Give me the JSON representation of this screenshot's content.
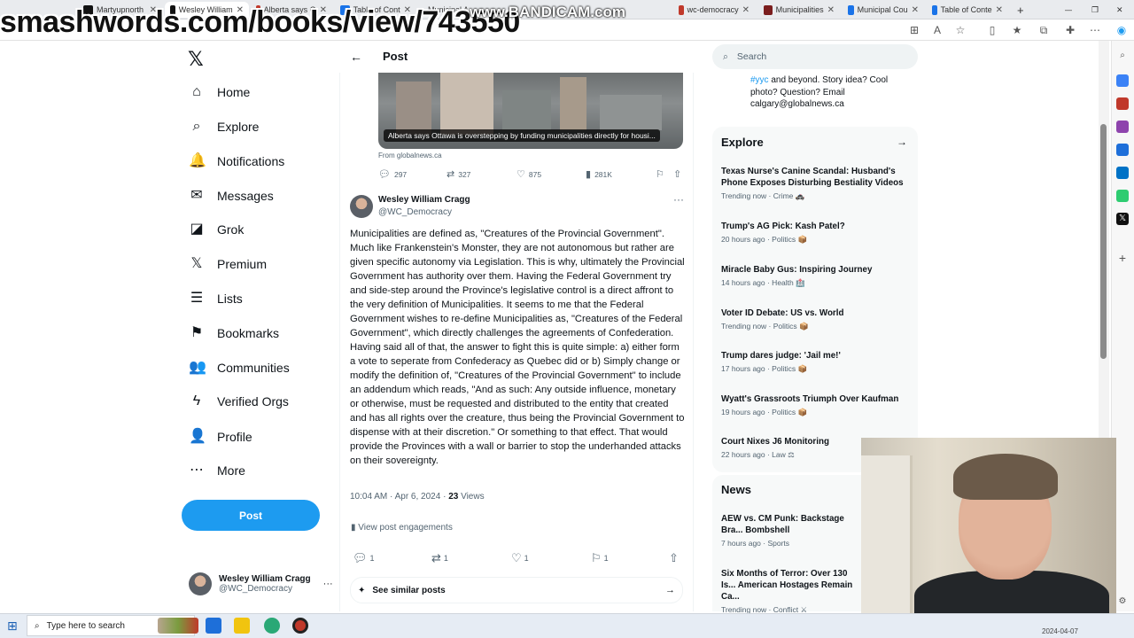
{
  "browser": {
    "tabs": [
      {
        "label": "Martyupnorth",
        "color": "#111111"
      },
      {
        "label": "Wesley William",
        "color": "#111111"
      },
      {
        "label": "Alberta says O",
        "color": "#c0392b"
      },
      {
        "label": "Table of Cont",
        "color": "#1a73e8"
      },
      {
        "label": "Municipal A",
        "color": "#8e44ad"
      },
      {
        "label": "wc-democracy",
        "color": "#c0392b"
      },
      {
        "label": "Municipalities",
        "color": "#7b1e1e"
      },
      {
        "label": "Municipal Cou",
        "color": "#1a73e8"
      },
      {
        "label": "Table of Conte",
        "color": "#1a73e8"
      }
    ],
    "watermark": "smashwords.com/books/view/743550",
    "recorder": "www.BANDICAM.com"
  },
  "sidebar": {
    "logo": "𝕏",
    "items": [
      {
        "label": "Home",
        "icon": "⌂"
      },
      {
        "label": "Explore",
        "icon": "⌕"
      },
      {
        "label": "Notifications",
        "icon": "🔔"
      },
      {
        "label": "Messages",
        "icon": "✉"
      },
      {
        "label": "Grok",
        "icon": "◪"
      },
      {
        "label": "Premium",
        "icon": "𝕏"
      },
      {
        "label": "Lists",
        "icon": "☰"
      },
      {
        "label": "Bookmarks",
        "icon": "⚑"
      },
      {
        "label": "Communities",
        "icon": "👥"
      },
      {
        "label": "Verified Orgs",
        "icon": "ϟ"
      },
      {
        "label": "Profile",
        "icon": "👤"
      },
      {
        "label": "More",
        "icon": "⋯"
      }
    ],
    "post_button": "Post",
    "account": {
      "name": "Wesley William Cragg",
      "handle": "@WC_Democracy",
      "more": "···"
    }
  },
  "header": {
    "back": "←",
    "title": "Post"
  },
  "quoted": {
    "caption": "Alberta says Ottawa is overstepping by funding municipalities directly for housi...",
    "source": "From globalnews.ca",
    "stats": {
      "replies": "297",
      "reposts": "327",
      "likes": "875",
      "views": "281K"
    }
  },
  "tweet": {
    "author": "Wesley William Cragg",
    "handle": "@WC_Democracy",
    "more": "···",
    "body": "Municipalities are defined as, \"Creatures of the Provincial Government\". Much like Frankenstein's Monster, they are not autonomous but rather are given specific autonomy via Legislation. This is why, ultimately the Provincial Government has authority over them. Having the Federal Government try and side-step around the Province's legislative control is a direct affront to the very definition of Municipalities. It seems to me that the Federal Government wishes to re-define Municipalities as, \"Creatures of the Federal Government\", which directly challenges the agreements of Confederation. Having said all of that, the answer to fight this is quite simple: a) either form a vote to seperate from Confederacy as Quebec did or b) Simply change or modify the definition of, \"Creatures of the Provincial Government\" to include an addendum which reads, \"And as such: Any outside influence, monetary or otherwise, must be requested and distributed to the entity that created and has all rights over the creature, thus being the Provincial Government to dispense with at their discretion.\" Or something to that effect. That would provide the Provinces with a wall or barrier to stop the underhanded attacks on their sovereignty.",
    "timestamp": "10:04 AM · Apr 6, 2024 · ",
    "views_count": "23",
    "views_label": " Views",
    "engagements": "View post engagements",
    "actions": {
      "replies": "1",
      "reposts": "1",
      "likes": "1",
      "bookmarks": "1"
    },
    "similar": "See similar posts"
  },
  "right": {
    "search_placeholder": "Search",
    "bio_tag": "#yyc",
    "bio_rest": " and beyond. Story idea? Cool photo? Question? Email calgary@globalnews.ca",
    "explore_title": "Explore",
    "trends": [
      {
        "title": "Texas Nurse's Canine Scandal: Husband's Phone Exposes Disturbing Bestiality Videos",
        "meta": "Trending now · Crime 🚓"
      },
      {
        "title": "Trump's AG Pick: Kash Patel?",
        "meta": "20 hours ago · Politics 📦"
      },
      {
        "title": "Miracle Baby Gus: Inspiring Journey",
        "meta": "14 hours ago · Health 🏥"
      },
      {
        "title": "Voter ID Debate: US vs. World",
        "meta": "Trending now · Politics 📦"
      },
      {
        "title": "Trump dares judge: 'Jail me!'",
        "meta": "17 hours ago · Politics 📦"
      },
      {
        "title": "Wyatt's Grassroots Triumph Over Kaufman",
        "meta": "19 hours ago · Politics 📦"
      },
      {
        "title": "Court Nixes J6 Monitoring",
        "meta": "22 hours ago · Law ⚖"
      }
    ],
    "news_title": "News",
    "news": [
      {
        "title": "AEW vs. CM Punk: Backstage Bra... Bombshell",
        "meta": "7 hours ago · Sports"
      },
      {
        "title": "Six Months of Terror: Over 130 Is... American Hostages Remain Ca...",
        "meta": "Trending now · Conflict ⚔"
      }
    ]
  },
  "taskbar": {
    "search_placeholder": "Type here to search",
    "date": "2024-04-07"
  }
}
